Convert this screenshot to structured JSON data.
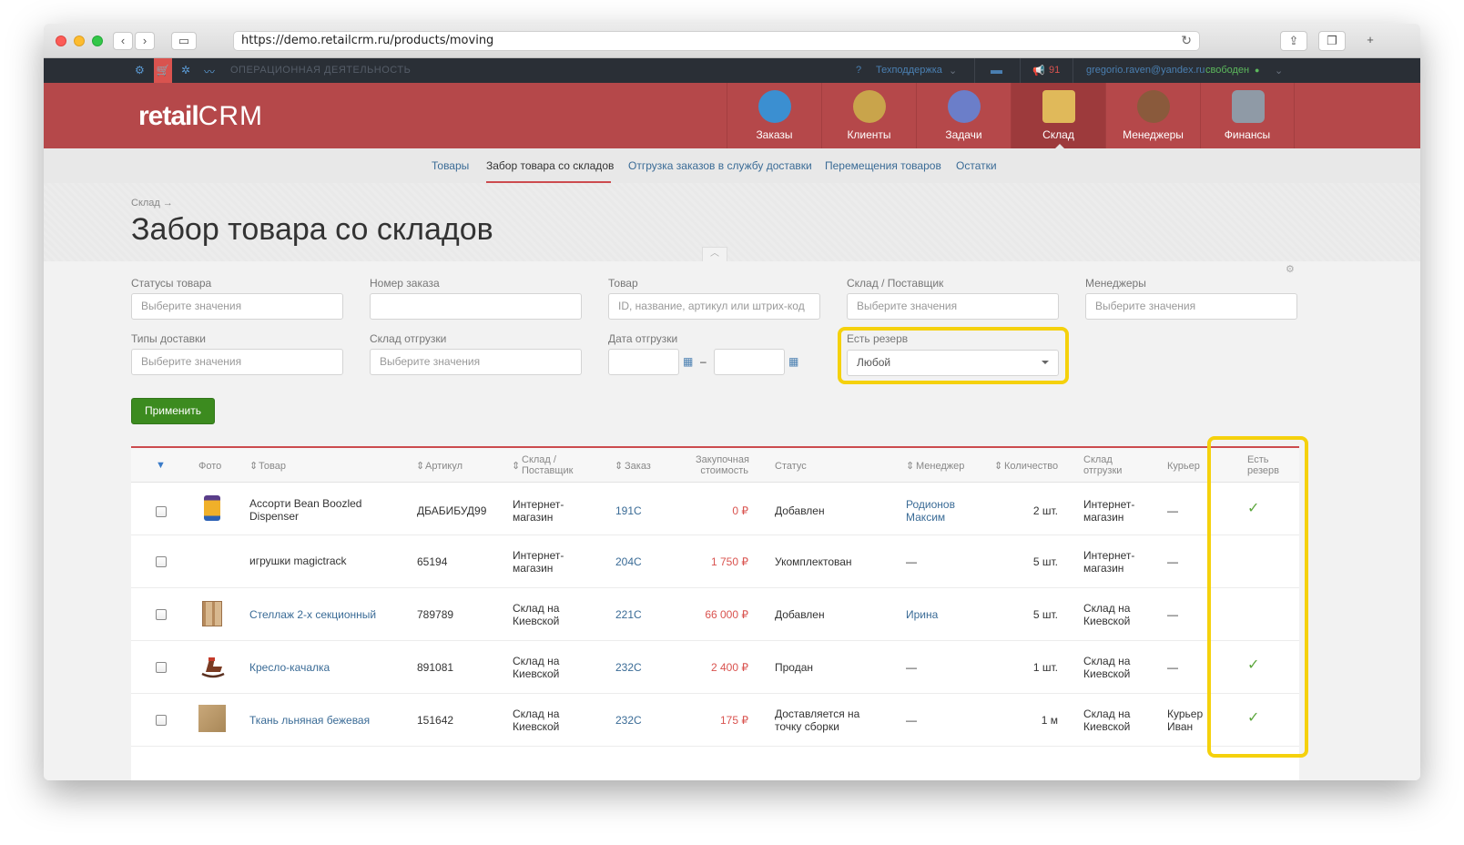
{
  "browser": {
    "url": "https://demo.retailcrm.ru/products/moving"
  },
  "topbar": {
    "section_label": "ОПЕРАЦИОННАЯ ДЕЯТЕЛЬНОСТЬ",
    "support": "Техподдержка",
    "notifications_count": "91",
    "user_email": "gregorio.raven@yandex.ru",
    "user_status": "свободен"
  },
  "header": {
    "logo_main": "retail",
    "logo_crm": "CRM",
    "modules": [
      {
        "label": "Заказы",
        "icon": "cart-icon",
        "color": "#3b8fd1"
      },
      {
        "label": "Клиенты",
        "icon": "person-icon",
        "color": "#c9a44b"
      },
      {
        "label": "Задачи",
        "icon": "list-icon",
        "color": "#6b7ec9"
      },
      {
        "label": "Склад",
        "icon": "box-icon",
        "color": "#e0b95a"
      },
      {
        "label": "Менеджеры",
        "icon": "manager-icon",
        "color": "#8a5a3c"
      },
      {
        "label": "Финансы",
        "icon": "calculator-icon",
        "color": "#8f9aa6"
      }
    ]
  },
  "subnav": {
    "items": [
      "Товары",
      "Забор товара со складов",
      "Отгрузка заказов в службу доставки",
      "Перемещения товаров",
      "Остатки"
    ]
  },
  "page": {
    "breadcrumb": "Склад →",
    "title": "Забор товара со складов"
  },
  "filters": {
    "statuses": {
      "label": "Статусы товара",
      "placeholder": "Выберите значения"
    },
    "order_number": {
      "label": "Номер заказа",
      "placeholder": ""
    },
    "product": {
      "label": "Товар",
      "placeholder": "ID, название, артикул или штрих-код"
    },
    "warehouse": {
      "label": "Склад / Поставщик",
      "placeholder": "Выберите значения"
    },
    "managers": {
      "label": "Менеджеры",
      "placeholder": "Выберите значения"
    },
    "delivery_types": {
      "label": "Типы доставки",
      "placeholder": "Выберите значения"
    },
    "ship_warehouse": {
      "label": "Склад отгрузки",
      "placeholder": "Выберите значения"
    },
    "ship_date": {
      "label": "Дата отгрузки",
      "separator": "–"
    },
    "reserve": {
      "label": "Есть резерв",
      "value": "Любой"
    },
    "apply_label": "Применить"
  },
  "table": {
    "headers": {
      "photo": "Фото",
      "product": "Товар",
      "sku": "Артикул",
      "warehouse_line1": "Склад /",
      "warehouse_line2": "Поставщик",
      "order": "Заказ",
      "cost_line1": "Закупочная",
      "cost_line2": "стоимость",
      "status": "Статус",
      "manager": "Менеджер",
      "quantity": "Количество",
      "ship_line1": "Склад",
      "ship_line2": "отгрузки",
      "courier": "Курьер",
      "reserve_line1": "Есть",
      "reserve_line2": "резерв"
    },
    "rows": [
      {
        "product_line1": "Ассорти Bean Boozled",
        "product_line2": "Dispenser",
        "product_link": false,
        "thumb": "jar",
        "sku": "ДБАБИБУД99",
        "wh_line1": "Интернет-",
        "wh_line2": "магазин",
        "order": "191С",
        "cost": "0 ₽",
        "status_line1": "Добавлен",
        "status_line2": "",
        "manager_line1": "Родионов",
        "manager_line2": "Максим",
        "manager_link": true,
        "qty": "2 шт.",
        "ship_line1": "Интернет-",
        "ship_line2": "магазин",
        "courier_line1": "—",
        "courier_line2": "",
        "reserve": "✓"
      },
      {
        "product_line1": "игрушки magictrack",
        "product_line2": "",
        "product_link": false,
        "thumb": "",
        "sku": "65194",
        "wh_line1": "Интернет-",
        "wh_line2": "магазин",
        "order": "204С",
        "cost": "1 750 ₽",
        "status_line1": "Укомплектован",
        "status_line2": "",
        "manager_line1": "—",
        "manager_line2": "",
        "manager_link": false,
        "qty": "5 шт.",
        "ship_line1": "Интернет-",
        "ship_line2": "магазин",
        "courier_line1": "—",
        "courier_line2": "",
        "reserve": ""
      },
      {
        "product_line1": "Стеллаж 2-х секционный",
        "product_line2": "",
        "product_link": true,
        "thumb": "shelf",
        "sku": "789789",
        "wh_line1": "Склад на",
        "wh_line2": "Киевской",
        "order": "221С",
        "cost": "66 000 ₽",
        "status_line1": "Добавлен",
        "status_line2": "",
        "manager_line1": "Ирина",
        "manager_line2": "",
        "manager_link": true,
        "qty": "5 шт.",
        "ship_line1": "Склад на",
        "ship_line2": "Киевской",
        "courier_line1": "—",
        "courier_line2": "",
        "reserve": ""
      },
      {
        "product_line1": "Кресло-качалка",
        "product_line2": "",
        "product_link": true,
        "thumb": "chair",
        "sku": "891081",
        "wh_line1": "Склад на",
        "wh_line2": "Киевской",
        "order": "232С",
        "cost": "2 400 ₽",
        "status_line1": "Продан",
        "status_line2": "",
        "manager_line1": "—",
        "manager_line2": "",
        "manager_link": false,
        "qty": "1 шт.",
        "ship_line1": "Склад на",
        "ship_line2": "Киевской",
        "courier_line1": "—",
        "courier_line2": "",
        "reserve": "✓"
      },
      {
        "product_line1": "Ткань льняная бежевая",
        "product_line2": "",
        "product_link": true,
        "thumb": "fabric",
        "sku": "151642",
        "wh_line1": "Склад на",
        "wh_line2": "Киевской",
        "order": "232С",
        "cost": "175 ₽",
        "status_line1": "Доставляется на",
        "status_line2": "точку сборки",
        "manager_line1": "—",
        "manager_line2": "",
        "manager_link": false,
        "qty": "1 м",
        "ship_line1": "Склад на",
        "ship_line2": "Киевской",
        "courier_line1": "Курьер",
        "courier_line2": "Иван",
        "reserve": "✓"
      }
    ]
  }
}
